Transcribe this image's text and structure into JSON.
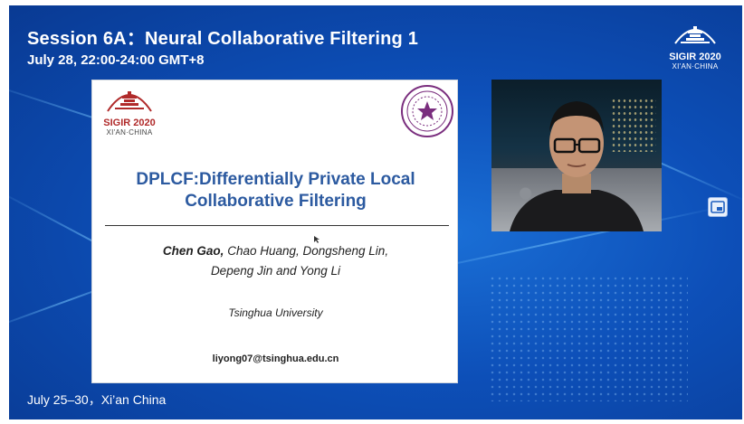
{
  "header": {
    "session_title": "Session 6A：Neural Collaborative Filtering 1",
    "session_time": "July 28, 22:00-24:00 GMT+8"
  },
  "corner_logo": {
    "name": "SIGIR 2020",
    "place": "XI'AN·CHINA"
  },
  "slide": {
    "logo_left": {
      "name": "SIGIR 2020",
      "place": "XI'AN·CHINA"
    },
    "title_line1": "DPLCF:Differentially Private Local",
    "title_line2": "Collaborative Filtering",
    "authors_lead": "Chen Gao,",
    "authors_rest_line1": " Chao Huang, Dongsheng Lin,",
    "authors_line2": "Depeng Jin and Yong Li",
    "affiliation": "Tsinghua University",
    "email": "liyong07@tsinghua.edu.cn",
    "logo_right_icon": "tsinghua-seal-icon"
  },
  "webcam": {
    "icon": "speaker-video-feed"
  },
  "pip_button": {
    "icon": "picture-in-picture-icon"
  },
  "footer": {
    "text": "July 25–30，Xi’an China"
  },
  "colors": {
    "background": "#0d4fb8",
    "slide_title": "#2c5aa0",
    "logo_red": "#b02a2a",
    "seal_purple": "#7a2e7e"
  }
}
